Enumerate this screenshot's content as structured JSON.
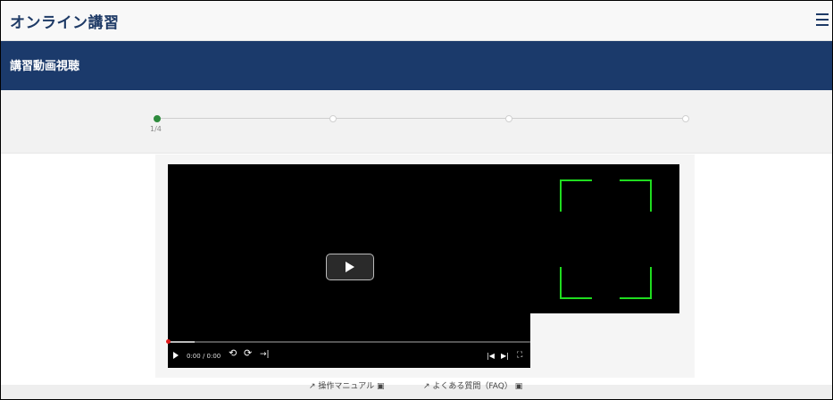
{
  "header": {
    "app_title": "オンライン講習",
    "menu_icon": "hamburger-icon"
  },
  "section": {
    "title": "講習動画視聴"
  },
  "progress": {
    "current_label": "1/4",
    "total_steps": 4,
    "current_step": 1
  },
  "player": {
    "time": "0:00 / 0:00",
    "play_icon": "play-icon",
    "rewind_icon": "rewind-10-icon",
    "forward_icon": "forward-10-icon",
    "skip_icon": "skip-to-end-icon",
    "prev_icon": "previous-icon",
    "next_icon": "next-icon",
    "fullscreen_icon": "fullscreen-icon",
    "progress": 0
  },
  "footer": {
    "manual_link": "操作マニュアル",
    "faq_link": "よくある質問（FAQ）"
  },
  "colors": {
    "nav": "#1b3a6b",
    "accent_green": "#2e8b3d",
    "frame_green": "#1fdc1f",
    "seek_head": "#e01a1a"
  }
}
